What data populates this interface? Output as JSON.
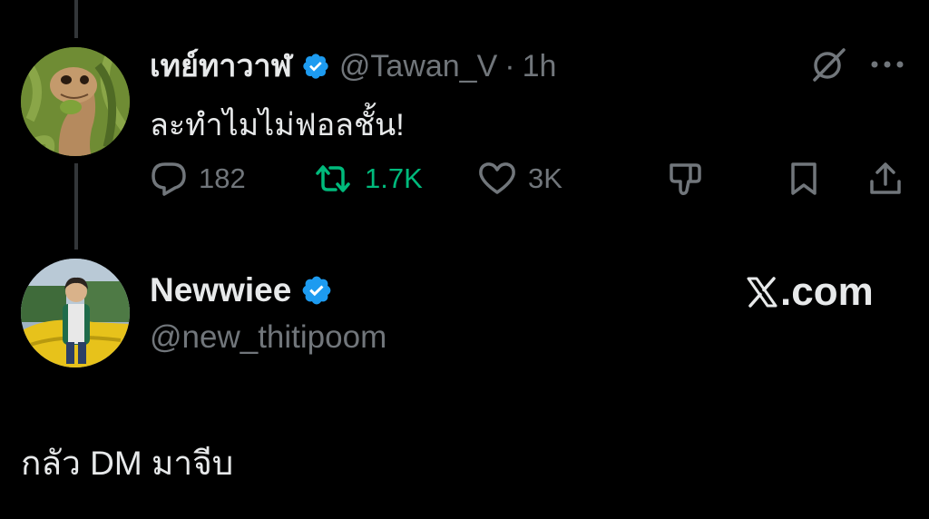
{
  "colors": {
    "background": "#000000",
    "text_primary": "#e7e9ea",
    "text_secondary": "#71767b",
    "verified_blue": "#1d9bf0",
    "retweet_green": "#00ba7c",
    "thread_line": "#333639"
  },
  "parent_post": {
    "display_name": "เทย์ทาวาฬ",
    "handle": "@Tawan_V",
    "separator": "·",
    "time": "1h",
    "text": "ละทำไมไม่ฟอลชั้น!",
    "actions": {
      "replies": "182",
      "retweets": "1.7K",
      "likes": "3K"
    },
    "icons": [
      "verified-badge-icon",
      "grok-icon",
      "more-icon",
      "reply-icon",
      "retweet-icon",
      "like-icon",
      "dislike-icon",
      "bookmark-icon",
      "share-icon"
    ]
  },
  "main_post": {
    "display_name": "Newwiee",
    "handle": "@new_thitipoom",
    "brand_text": ".com",
    "text": "กลัว DM มาจีบ",
    "icons": [
      "verified-badge-icon",
      "x-logo-icon"
    ]
  }
}
